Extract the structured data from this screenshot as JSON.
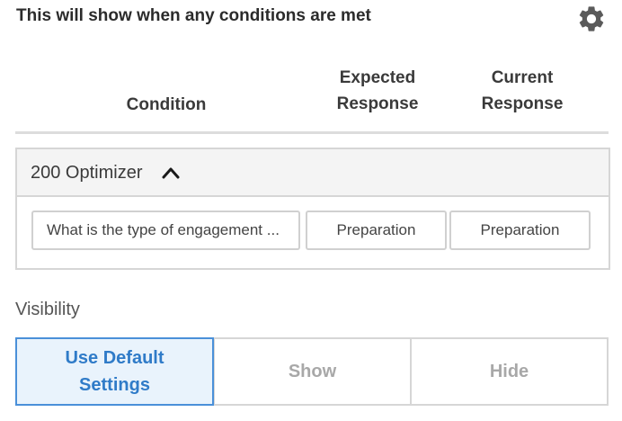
{
  "header": {
    "title": "This will show when any conditions are met",
    "settings_icon": "gear-icon"
  },
  "columns": {
    "condition": "Condition",
    "expected": "Expected\nResponse",
    "current": "Current\nResponse"
  },
  "group": {
    "name": "200 Optimizer",
    "toggle_icon": "chevron-up-icon",
    "rows": [
      {
        "condition": "What is the type of engagement ...",
        "expected": "Preparation",
        "current": "Preparation"
      }
    ]
  },
  "visibility": {
    "label": "Visibility",
    "options": [
      {
        "label": "Use Default\nSettings",
        "selected": true
      },
      {
        "label": "Show",
        "selected": false
      },
      {
        "label": "Hide",
        "selected": false
      }
    ]
  },
  "colors": {
    "accent": "#4a90d9",
    "selected_bg": "#e9f3fc",
    "border": "#d6d6d6"
  }
}
